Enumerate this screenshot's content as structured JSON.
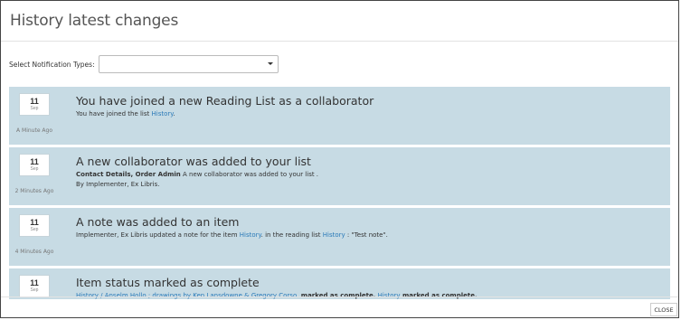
{
  "dialog": {
    "title": "History latest changes"
  },
  "filter": {
    "label": "Select Notification Types:",
    "value": ""
  },
  "notifications": [
    {
      "day": "11",
      "month": "Sep",
      "ago": "A Minute Ago",
      "title": "You have joined a new Reading List as a collaborator",
      "l1_text": "You have joined the list ",
      "l1_link": "History",
      "l1_end": "."
    },
    {
      "day": "11",
      "month": "Sep",
      "ago": "2 Minutes Ago",
      "title": "A new collaborator was added to your list",
      "l1_bold": "Contact Details, Order Admin",
      "l1_text": " A new collaborator was added to your list .",
      "l2_text": "By Implementer, Ex Libris."
    },
    {
      "day": "11",
      "month": "Sep",
      "ago": "4 Minutes Ago",
      "title": "A note was added to an item",
      "l1_text": "Implementer, Ex Libris updated a note for the item ",
      "l1_link": "History",
      "l1_mid": ". in the reading list ",
      "l1_link2": "History",
      "l1_end": " : \"Test note\"."
    },
    {
      "day": "11",
      "month": "Sep",
      "ago": "",
      "title": "Item status marked as complete",
      "l1_link": "History / Anselm Hollo ; drawings by Ken Lansdowne & Gregory Corso.",
      "l1_bold": " marked as complete.",
      "l1_link2": " History",
      "l1_bold2": " marked as complete."
    }
  ],
  "footer": {
    "close_label": "CLOSE"
  }
}
